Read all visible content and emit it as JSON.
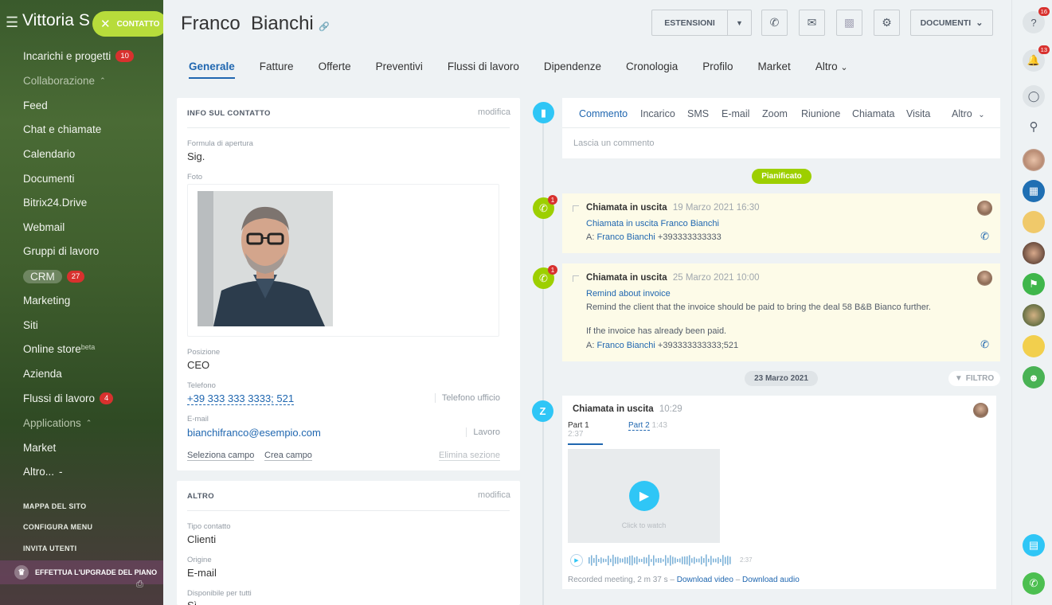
{
  "portal": {
    "title": "Vittoria S",
    "contact_button": "CONTATTO"
  },
  "sidebar": {
    "items": [
      {
        "label": "Incarichi e progetti",
        "badge": "10"
      },
      {
        "label": "Collaborazione"
      },
      {
        "label": "Feed"
      },
      {
        "label": "Chat e chiamate"
      },
      {
        "label": "Calendario"
      },
      {
        "label": "Documenti"
      },
      {
        "label": "Bitrix24.Drive"
      },
      {
        "label": "Webmail"
      },
      {
        "label": "Gruppi di lavoro"
      },
      {
        "label": "CRM",
        "badge": "27"
      },
      {
        "label": "Marketing"
      },
      {
        "label": "Siti"
      },
      {
        "label": "Online store",
        "sup": "beta"
      },
      {
        "label": "Azienda"
      },
      {
        "label": "Flussi di lavoro",
        "badge": "4"
      },
      {
        "label": "Applications"
      },
      {
        "label": "Market"
      },
      {
        "label": "Altro..."
      }
    ],
    "bottom": [
      "MAPPA DEL SITO",
      "CONFIGURA MENU",
      "INVITA UTENTI"
    ],
    "upgrade": "EFFETTUA L'UPGRADE DEL PIANO"
  },
  "header": {
    "title": "Franco  Bianchi",
    "extensions": "ESTENSIONI",
    "documents": "DOCUMENTI"
  },
  "tabs": [
    "Generale",
    "Fatture",
    "Offerte",
    "Preventivi",
    "Flussi di lavoro",
    "Dipendenze",
    "Cronologia",
    "Profilo",
    "Market",
    "Altro"
  ],
  "contact_card": {
    "heading": "INFO SUL CONTATTO",
    "edit": "modifica",
    "salutation_label": "Formula di apertura",
    "salutation": "Sig.",
    "photo_label": "Foto",
    "position_label": "Posizione",
    "position": "CEO",
    "phone_label": "Telefono",
    "phone": "+39 333 333 3333; 521",
    "phone_type": "Telefono ufficio",
    "email_label": "E-mail",
    "email": "bianchifranco@esempio.com",
    "email_type": "Lavoro",
    "select_field": "Seleziona campo",
    "create_field": "Crea campo",
    "delete_section": "Elimina sezione"
  },
  "other_card": {
    "heading": "ALTRO",
    "edit": "modifica",
    "type_label": "Tipo contatto",
    "type": "Clienti",
    "source_label": "Origine",
    "source": "E-mail",
    "available_label": "Disponibile per tutti",
    "available": "Sì"
  },
  "composer": {
    "tabs": [
      "Commento",
      "Incarico",
      "SMS",
      "E-mail",
      "Zoom",
      "Riunione",
      "Chiamata",
      "Visita",
      "Altro"
    ],
    "placeholder": "Lascia un commento"
  },
  "planned_label": "Pianificato",
  "events": [
    {
      "title": "Chiamata in uscita",
      "time": "19 Marzo 2021 16:30",
      "link": "Chiamata in uscita Franco Bianchi",
      "to_prefix": "A:",
      "to_name": "Franco Bianchi",
      "to_number": "+393333333333"
    },
    {
      "title": "Chiamata in uscita",
      "time": "25 Marzo 2021 10:00",
      "link": "Remind about invoice",
      "line1": "Remind the client that the invoice should be paid to bring the deal 58 B&B Bianco further.",
      "line2": "If the invoice has already been paid.",
      "to_prefix": "A:",
      "to_name": "Franco Bianchi",
      "to_number": "+393333333333;521"
    }
  ],
  "date_divider": "23 Marzo 2021",
  "filter_label": "FILTRO",
  "zoom_event": {
    "title": "Chiamata in uscita",
    "time": "10:29",
    "part1": "Part 1",
    "part1_dur": "2:37",
    "part2": "Part 2",
    "part2_dur": "1:43",
    "click_to_watch": "Click to watch",
    "audio_dur": "2:37",
    "footer_prefix": "Recorded meeting, 2 m 37 s",
    "download_video": "Download video",
    "download_audio": "Download audio"
  },
  "rightbar": {
    "help_badge": "16",
    "notif_badge": "13"
  },
  "colors": {
    "accent": "#2067b0",
    "green": "#b7dc3b",
    "badge": "#d8312e",
    "timeline_blue": "#2fc6f6",
    "timeline_green": "#9dcf00"
  }
}
